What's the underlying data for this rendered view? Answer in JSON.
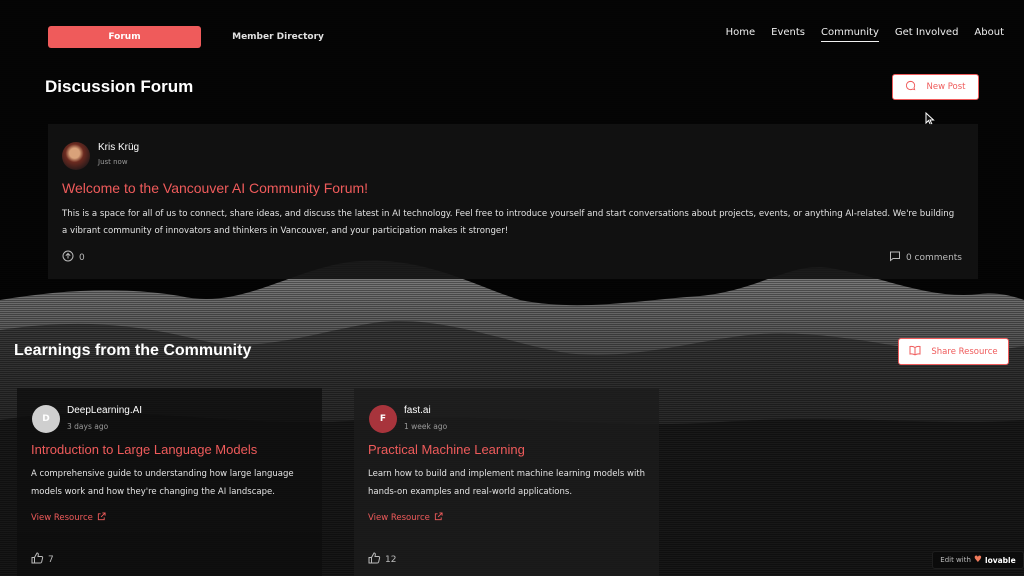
{
  "tabs": {
    "forum": "Forum",
    "directory": "Member Directory"
  },
  "nav": {
    "items": [
      "Home",
      "Events",
      "Community",
      "Get Involved",
      "About"
    ],
    "active": "Community"
  },
  "forum": {
    "heading": "Discussion Forum",
    "new_post_label": "New Post",
    "post": {
      "author": "Kris Krüg",
      "time": "Just now",
      "title": "Welcome to the Vancouver AI Community Forum!",
      "body": "This is a space for all of us to connect, share ideas, and discuss the latest in AI technology. Feel free to introduce yourself and start conversations about projects, events, or anything AI-related. We're building a vibrant community of innovators and thinkers in Vancouver, and your participation makes it stronger!",
      "votes": "0",
      "comments": "0 comments"
    }
  },
  "learnings": {
    "heading": "Learnings from the Community",
    "share_label": "Share Resource",
    "resources": [
      {
        "initial": "D",
        "source": "DeepLearning.AI",
        "time": "3 days ago",
        "title": "Introduction to Large Language Models",
        "description": "A comprehensive guide to understanding how large language models work and how they're changing the AI landscape.",
        "link": "View Resource",
        "likes": "7",
        "avatar_color": "#cfcfcf"
      },
      {
        "initial": "F",
        "source": "fast.ai",
        "time": "1 week ago",
        "title": "Practical Machine Learning",
        "description": "Learn how to build and implement machine learning models with hands-on examples and real-world applications.",
        "link": "View Resource",
        "likes": "12",
        "avatar_color": "#a8343c"
      }
    ]
  },
  "badge": {
    "prefix": "Edit with",
    "brand": "lovable"
  },
  "colors": {
    "accent": "#ef5b5b",
    "background": "#050505"
  }
}
